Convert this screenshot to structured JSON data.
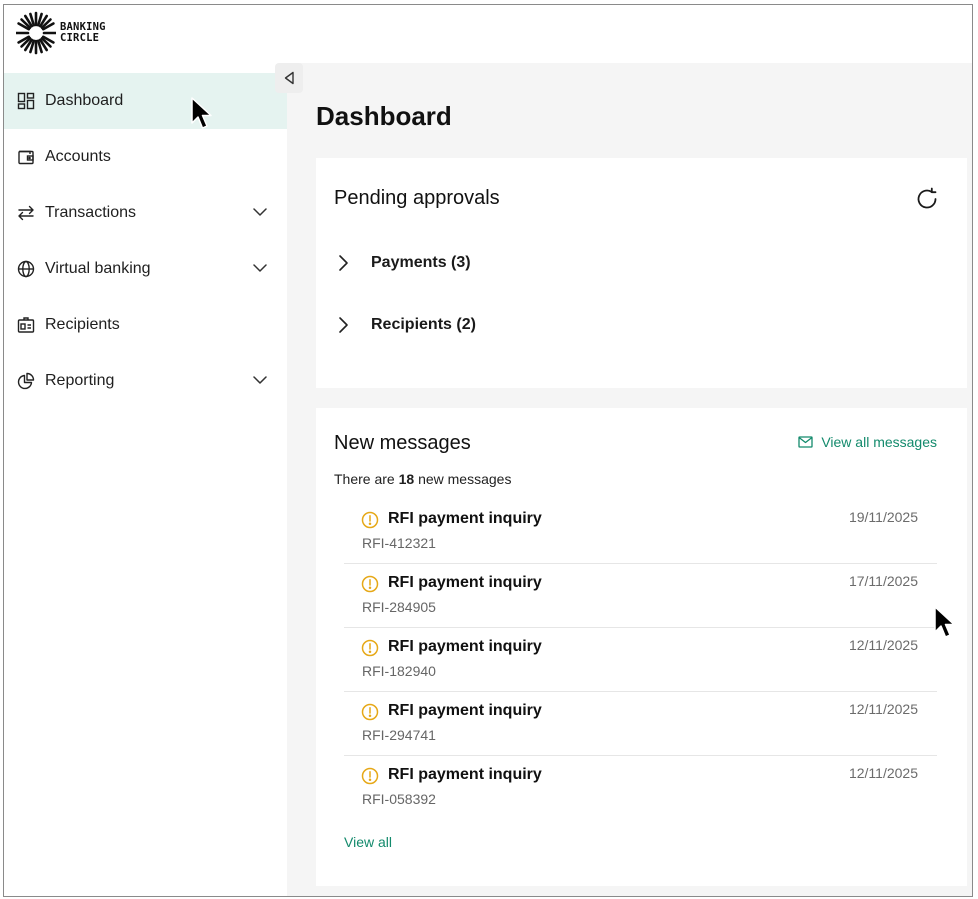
{
  "brand": {
    "line1": "BANKING",
    "line2": "CIRCLE"
  },
  "sidebar": {
    "items": [
      {
        "label": "Dashboard",
        "icon": "dashboard-icon",
        "active": true
      },
      {
        "label": "Accounts",
        "icon": "wallet-icon"
      },
      {
        "label": "Transactions",
        "icon": "arrows-transfer-icon",
        "expandable": true
      },
      {
        "label": "Virtual banking",
        "icon": "globe-icon",
        "expandable": true
      },
      {
        "label": "Recipients",
        "icon": "contact-card-icon"
      },
      {
        "label": "Reporting",
        "icon": "pie-chart-icon",
        "expandable": true
      }
    ]
  },
  "main": {
    "title": "Dashboard",
    "pending": {
      "title": "Pending approvals",
      "rows": [
        {
          "label": "Payments (3)"
        },
        {
          "label": "Recipients (2)"
        }
      ]
    },
    "messages": {
      "title": "New messages",
      "view_all_messages": "View all messages",
      "count_prefix": "There are",
      "count": "18",
      "count_suffix": "new messages",
      "items": [
        {
          "subject": "RFI payment inquiry",
          "ref": "RFI-412321",
          "date": "19/11/2025"
        },
        {
          "subject": "RFI payment inquiry",
          "ref": "RFI-284905",
          "date": "17/11/2025"
        },
        {
          "subject": "RFI payment inquiry",
          "ref": "RFI-182940",
          "date": "12/11/2025"
        },
        {
          "subject": "RFI payment inquiry",
          "ref": "RFI-294741",
          "date": "12/11/2025"
        },
        {
          "subject": "RFI payment inquiry",
          "ref": "RFI-058392",
          "date": "12/11/2025"
        }
      ],
      "view_all": "View all"
    }
  },
  "colors": {
    "accent": "#138a6c",
    "active_bg": "#e5f3f0",
    "warning": "#e6a817",
    "main_bg": "#f5f5f5"
  }
}
